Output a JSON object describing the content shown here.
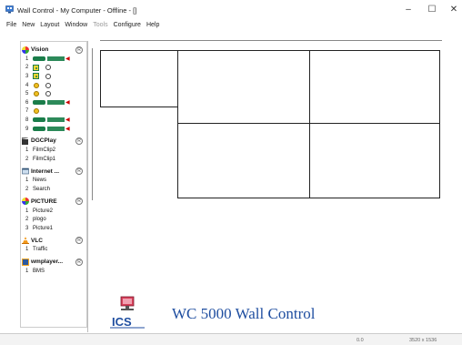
{
  "window": {
    "title": "Wall Control - My Computer - Offline - []",
    "minimize_glyph": "–",
    "maximize_glyph": "☐",
    "close_glyph": "✕"
  },
  "menu": {
    "items": [
      {
        "label": "File",
        "enabled": true
      },
      {
        "label": "New",
        "enabled": true
      },
      {
        "label": "Layout",
        "enabled": true
      },
      {
        "label": "Window",
        "enabled": true
      },
      {
        "label": "Tools",
        "enabled": false
      },
      {
        "label": "Configure",
        "enabled": true
      },
      {
        "label": "Help",
        "enabled": true
      }
    ]
  },
  "sidebar": {
    "vision": {
      "name": "Vision",
      "badge": "R",
      "rows": [
        {
          "num": "1",
          "device": "cam-chip-arrow"
        },
        {
          "num": "2",
          "device": "yellow-gray"
        },
        {
          "num": "3",
          "device": "yellow-gray"
        },
        {
          "num": "4",
          "device": "bulb-gray"
        },
        {
          "num": "5",
          "device": "bulb-gray"
        },
        {
          "num": "6",
          "device": "cam-chip-arrow"
        },
        {
          "num": "7",
          "device": "bulb"
        },
        {
          "num": "8",
          "device": "cam-chip-arrow"
        },
        {
          "num": "9",
          "device": "cam-chip-arrow"
        }
      ]
    },
    "groups": [
      {
        "name": "DGCPlay",
        "badge": "R",
        "icon": "film-icon",
        "items": [
          {
            "num": "1",
            "label": "FilmClip2"
          },
          {
            "num": "2",
            "label": "FilmClip1"
          }
        ]
      },
      {
        "name": "Internet ...",
        "badge": "R",
        "icon": "internet-icon",
        "items": [
          {
            "num": "1",
            "label": "News"
          },
          {
            "num": "2",
            "label": "Search"
          }
        ]
      },
      {
        "name": "PICTURE",
        "badge": "R",
        "icon": "picture-icon",
        "items": [
          {
            "num": "1",
            "label": "Picture2"
          },
          {
            "num": "2",
            "label": "plogo"
          },
          {
            "num": "3",
            "label": "Picture1"
          }
        ]
      },
      {
        "name": "VLC",
        "badge": "R",
        "icon": "vlc-cone-icon",
        "items": [
          {
            "num": "1",
            "label": "Traffic"
          }
        ]
      },
      {
        "name": "wmplayer...",
        "badge": "R",
        "icon": "wmplayer-icon",
        "items": [
          {
            "num": "1",
            "label": "BMS"
          }
        ]
      }
    ]
  },
  "banner": {
    "text": "WC 5000 Wall Control",
    "logo_text": "ICS"
  },
  "status": {
    "zoom": "0.0",
    "resolution": "3520 x 1536"
  },
  "colors": {
    "banner_text": "#1f4ea0",
    "device_green": "#1a7d4a",
    "device_yellow": "#f7d633",
    "alert_red": "#cc0000"
  }
}
